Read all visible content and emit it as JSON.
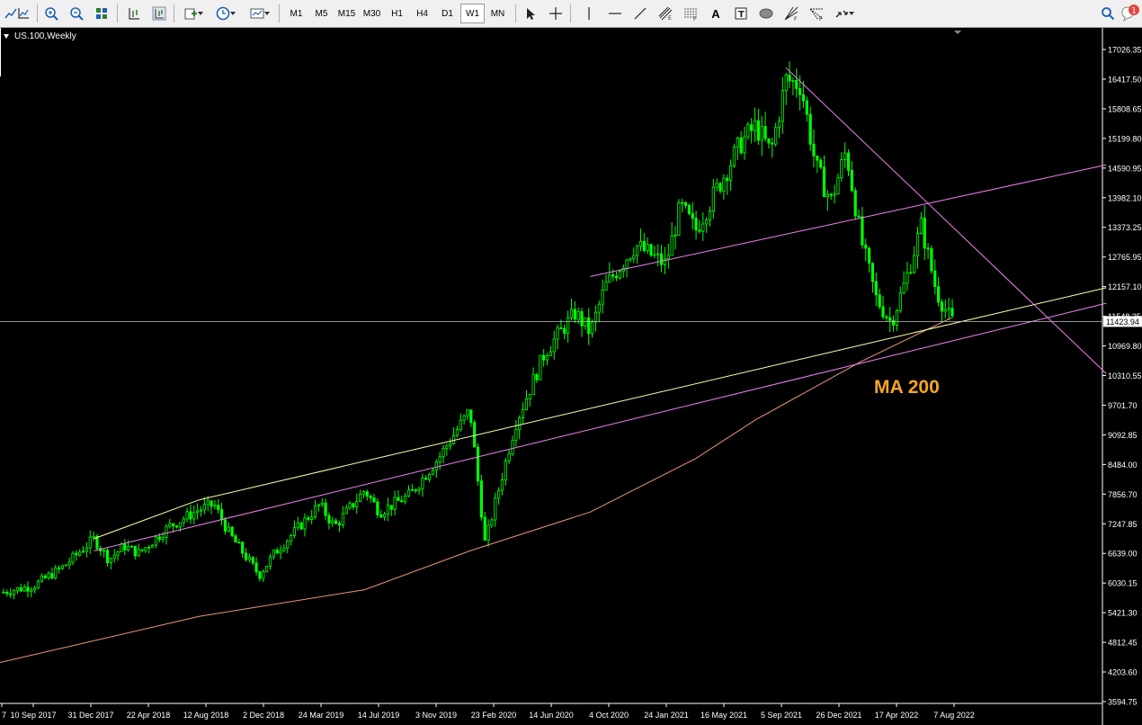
{
  "toolbar": {
    "icons": [
      "line-chart-icon",
      "chart-axis-icon",
      "zoom-in-icon",
      "zoom-out-icon",
      "tile-windows-icon",
      "chart-shift-icon",
      "autoscroll-icon",
      "new-order-icon",
      "clock-icon",
      "templates-icon"
    ],
    "timeframes": [
      "M1",
      "M5",
      "M15",
      "M30",
      "H1",
      "H4",
      "D1",
      "W1",
      "MN"
    ],
    "active_timeframe": "W1",
    "draw_icons": [
      "cursor-icon",
      "crosshair-icon",
      "vertical-line-icon",
      "horizontal-line-icon",
      "trendline-icon",
      "equidistant-channel-icon",
      "fibonacci-icon",
      "text-icon",
      "text-label-icon",
      "ellipse-icon",
      "gann-fan-icon",
      "fibo-fan-icon",
      "arrows-icon"
    ],
    "right_icons": [
      "search-icon",
      "notifications-icon"
    ],
    "notification_count": "1"
  },
  "chart": {
    "symbol": "US.100,Weekly",
    "ma_label": "MA 200",
    "current_price_label": "11423.94"
  },
  "chart_data": {
    "type": "candlestick",
    "title": "US.100,Weekly",
    "price_axis_ticks": [
      "17026.35",
      "16417.50",
      "15808.65",
      "15199.80",
      "14590.95",
      "13982.10",
      "13373.25",
      "12765.95",
      "12157.10",
      "11548.25",
      "10969.80",
      "10310.55",
      "9701.70",
      "9092.85",
      "8484.00",
      "7856.70",
      "7247.85",
      "6639.00",
      "6030.15",
      "5421.30",
      "4812.45",
      "4203.60",
      "3594.75"
    ],
    "time_axis_ticks": [
      "7",
      "10 Sep 2017",
      "31 Dec 2017",
      "22 Apr 2018",
      "12 Aug 2018",
      "2 Dec 2018",
      "24 Mar 2019",
      "14 Jul 2019",
      "3 Nov 2019",
      "23 Feb 2020",
      "14 Jun 2020",
      "4 Oct 2020",
      "24 Jan 2021",
      "16 May 2021",
      "5 Sep 2021",
      "26 Dec 2021",
      "17 Apr 2022",
      "7 Aug 2022"
    ],
    "ylim": [
      3594.75,
      17026.35
    ],
    "current_price": 11423.94,
    "close_path": [
      {
        "date": "Jul 2017",
        "close": 5850
      },
      {
        "date": "Sep 2017",
        "close": 5980
      },
      {
        "date": "Nov 2017",
        "close": 6380
      },
      {
        "date": "Jan 2018",
        "close": 6950
      },
      {
        "date": "Feb 2018",
        "close": 6520
      },
      {
        "date": "Mar 2018",
        "close": 6800
      },
      {
        "date": "Apr 2018",
        "close": 6650
      },
      {
        "date": "Jun 2018",
        "close": 7200
      },
      {
        "date": "Aug 2018",
        "close": 7550
      },
      {
        "date": "Sep 2018",
        "close": 7650
      },
      {
        "date": "Oct 2018",
        "close": 7050
      },
      {
        "date": "Dec 2018",
        "close": 6200
      },
      {
        "date": "Jan 2019",
        "close": 6650
      },
      {
        "date": "Apr 2019",
        "close": 7650
      },
      {
        "date": "May 2019",
        "close": 7200
      },
      {
        "date": "Jul 2019",
        "close": 7950
      },
      {
        "date": "Aug 2019",
        "close": 7500
      },
      {
        "date": "Oct 2019",
        "close": 7850
      },
      {
        "date": "Dec 2019",
        "close": 8650
      },
      {
        "date": "Feb 2020",
        "close": 9600
      },
      {
        "date": "Mar 2020",
        "close": 6850
      },
      {
        "date": "May 2020",
        "close": 9300
      },
      {
        "date": "Jul 2020",
        "close": 10800
      },
      {
        "date": "Sep 2020",
        "close": 11600
      },
      {
        "date": "Oct 2020",
        "close": 11200
      },
      {
        "date": "Nov 2020",
        "close": 12150
      },
      {
        "date": "Jan 2021",
        "close": 13000
      },
      {
        "date": "Mar 2021",
        "close": 12600
      },
      {
        "date": "Apr 2021",
        "close": 13800
      },
      {
        "date": "May 2021",
        "close": 13300
      },
      {
        "date": "Aug 2021",
        "close": 15100
      },
      {
        "date": "Sep 2021",
        "close": 15450
      },
      {
        "date": "Oct 2021",
        "close": 14900
      },
      {
        "date": "Nov 2021",
        "close": 16400
      },
      {
        "date": "Dec 2021",
        "close": 16300
      },
      {
        "date": "Jan 2022",
        "close": 14600
      },
      {
        "date": "Feb 2022",
        "close": 13900
      },
      {
        "date": "Mar 2022",
        "close": 14950
      },
      {
        "date": "Apr 2022",
        "close": 13100
      },
      {
        "date": "May 2022",
        "close": 11900
      },
      {
        "date": "Jun 2022",
        "close": 11400
      },
      {
        "date": "Jul 2022",
        "close": 12300
      },
      {
        "date": "Aug 2022",
        "close": 13400
      },
      {
        "date": "Sep 2022",
        "close": 12050
      },
      {
        "date": "Oct 2022",
        "close": 11430
      }
    ],
    "ma200": [
      {
        "date": "Jul 2017",
        "value": 4400
      },
      {
        "date": "Aug 2018",
        "value": 5350
      },
      {
        "date": "Jul 2019",
        "value": 5900
      },
      {
        "date": "Feb 2020",
        "value": 6700
      },
      {
        "date": "Oct 2020",
        "value": 7500
      },
      {
        "date": "May 2021",
        "value": 8600
      },
      {
        "date": "Sep 2021",
        "value": 9400
      },
      {
        "date": "Apr 2022",
        "value": 10600
      },
      {
        "date": "Aug 2022",
        "value": 11200
      },
      {
        "date": "Oct 2022",
        "value": 11500
      }
    ],
    "colors": {
      "bull": "#00ff00",
      "bear": "#00ff00",
      "ma200": "#e9967a",
      "channel_yellow": "#ffffb0",
      "channel_pink": "#ee82ee",
      "bid_line": "#c0c0c0",
      "ma_label": "#f5a623"
    }
  }
}
